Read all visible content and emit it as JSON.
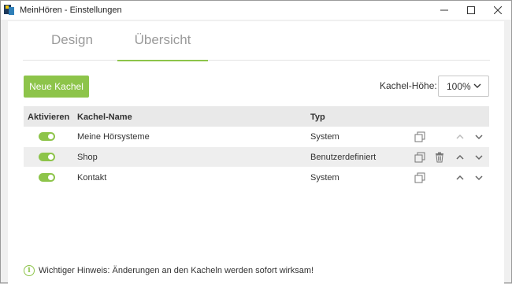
{
  "window": {
    "title": "MeinHören - Einstellungen"
  },
  "tabs": [
    {
      "label": "Design",
      "active": false
    },
    {
      "label": "Übersicht",
      "active": true
    }
  ],
  "toolbar": {
    "new_tile_label": "Neue Kachel",
    "tile_height_label": "Kachel-Höhe:",
    "tile_height_value": "100%"
  },
  "table": {
    "headers": {
      "activate": "Aktivieren",
      "name": "Kachel-Name",
      "type": "Typ"
    },
    "rows": [
      {
        "active": true,
        "name": "Meine Hörsysteme",
        "type": "System"
      },
      {
        "active": true,
        "name": "Shop",
        "type": "Benutzerdefiniert"
      },
      {
        "active": true,
        "name": "Kontakt",
        "type": "System"
      }
    ]
  },
  "notice": {
    "text": "Wichtiger Hinweis: Änderungen an den Kacheln werden sofort wirksam!"
  },
  "colors": {
    "accent": "#8dc44a"
  }
}
